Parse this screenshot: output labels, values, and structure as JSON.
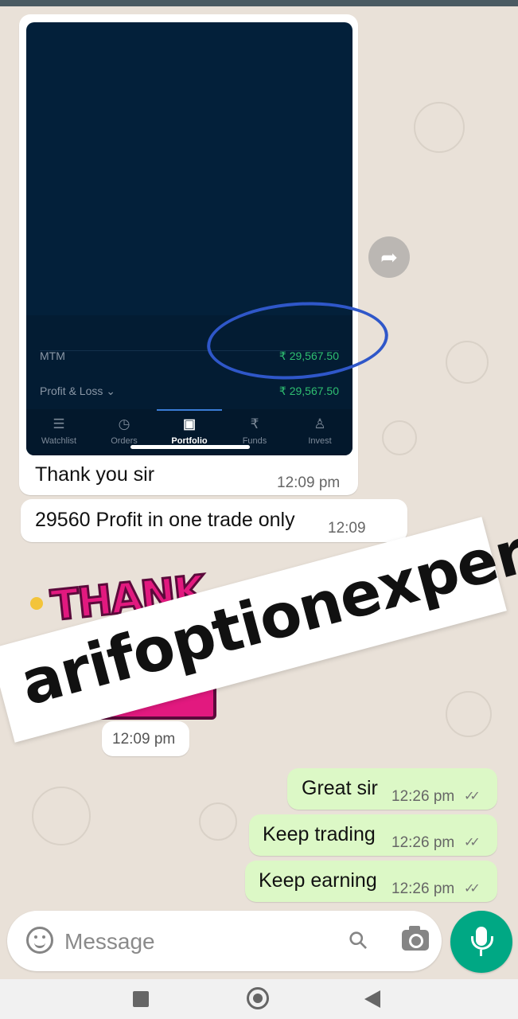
{
  "shared_screenshot": {
    "mtm_label": "MTM",
    "mtm_value": "₹ 29,567.50",
    "pl_label": "Profit & Loss ⌄",
    "pl_value": "₹ 29,567.50",
    "tabs": [
      {
        "label": "Watchlist",
        "icon": "☰"
      },
      {
        "label": "Orders",
        "icon": "◷"
      },
      {
        "label": "Portfolio",
        "icon": "▣"
      },
      {
        "label": "Funds",
        "icon": "₹"
      },
      {
        "label": "Invest",
        "icon": "♙"
      }
    ],
    "active_tab": "Portfolio"
  },
  "messages": {
    "image_caption": "Thank you sir",
    "image_time": "12:09 pm",
    "profit_text": "29560 Profit in one trade only",
    "profit_time": "12:09",
    "sticker_text": "THANK",
    "sticker_time": "12:09 pm",
    "outgoing": [
      {
        "text": "Great sir",
        "time": "12:26 pm"
      },
      {
        "text": "Keep trading",
        "time": "12:26 pm"
      },
      {
        "text": "Keep earning",
        "time": "12:26 pm"
      }
    ]
  },
  "watermark": "arifoptionexpert",
  "input": {
    "placeholder": "Message"
  },
  "colors": {
    "accent": "#00a884",
    "outgoing_bubble": "#dcf8c6",
    "profit_green": "#2fbf71"
  }
}
